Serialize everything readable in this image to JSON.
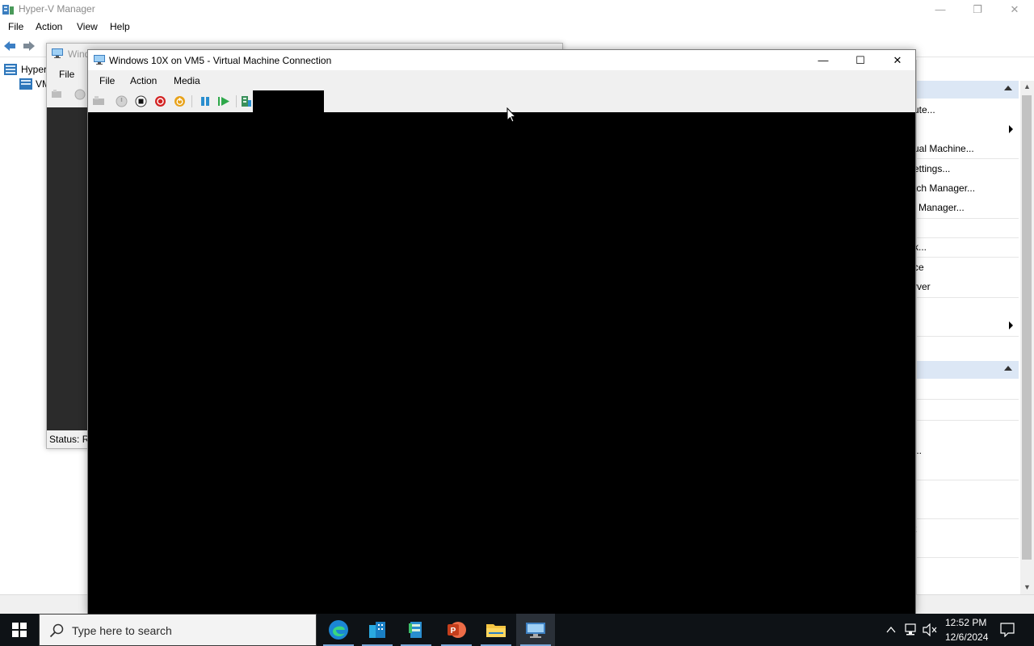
{
  "hyperv": {
    "title": "Hyper-V Manager",
    "menu": [
      "File",
      "Action",
      "View",
      "Help"
    ],
    "tree": {
      "root": "Hyper",
      "child": "VM"
    },
    "actions": {
      "items": [
        "ute...",
        "ual Machine...",
        "ettings...",
        "tch Manager...",
        "l Manager...",
        "k...",
        "ce",
        "rver",
        "...",
        "t"
      ]
    },
    "caption_buttons": [
      "—",
      "❐",
      "✕"
    ]
  },
  "bg_vm_window": {
    "title": "Wind",
    "menu_file": "File",
    "status": "Status: R"
  },
  "vm_window": {
    "title": "Windows 10X on VM5 - Virtual Machine Connection",
    "menu": [
      "File",
      "Action",
      "Media"
    ],
    "caption_buttons": [
      "—",
      "☐",
      "✕"
    ]
  },
  "taskbar": {
    "search_placeholder": "Type here to search",
    "time": "12:52 PM",
    "date": "12/6/2024"
  }
}
